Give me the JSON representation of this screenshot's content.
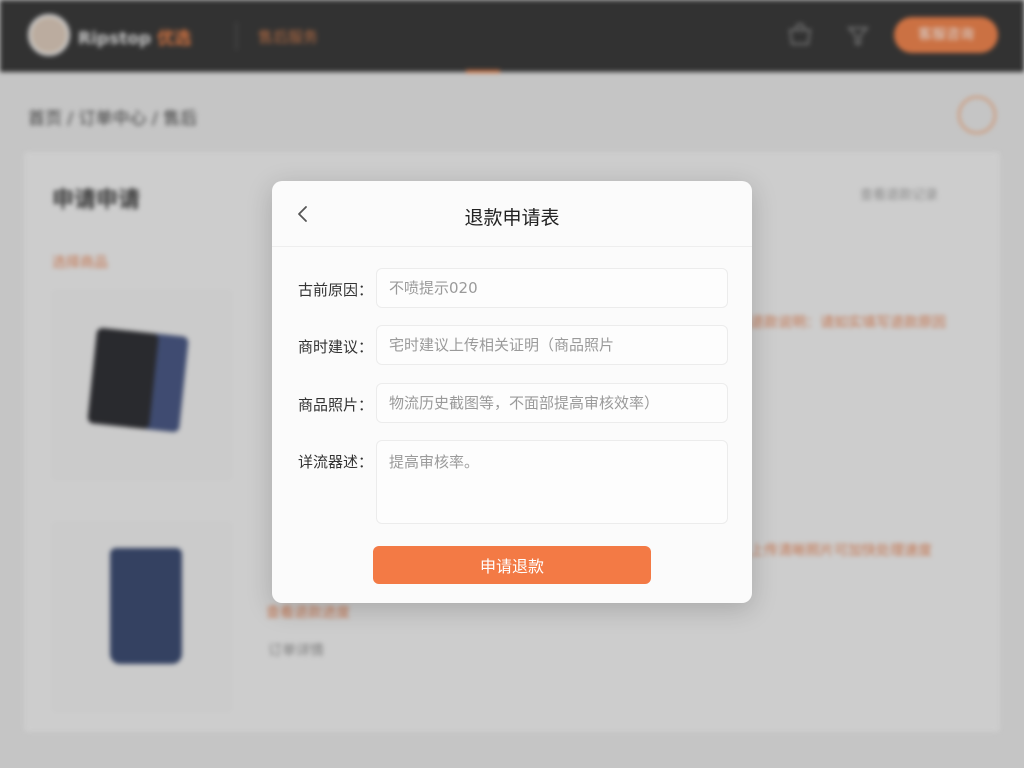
{
  "header": {
    "brand": "Ripstop",
    "brand_accent": "优选",
    "nav_item": "售后服务",
    "action_button": "客服咨询"
  },
  "breadcrumb": "首页 / 订单中心 / 售后",
  "panel": {
    "title": "申请申请",
    "subtitle": "选择商品",
    "right_link": "查看退款记录"
  },
  "side_notes": {
    "note_1": "退款说明：请如实填写退款原因",
    "note_2": "上传清晰照片可加快处理速度",
    "note_3": "查看退款进度",
    "note_4": "订单详情"
  },
  "modal": {
    "title": "退款申请表",
    "fields": [
      {
        "label": "古前原因：",
        "placeholder": "不喷提示020"
      },
      {
        "label": "商时建议：",
        "placeholder": "宅时建议上传相关证明（商品照片"
      },
      {
        "label": "商品照片：",
        "placeholder": "物流历史截图等，不面部提高审核效率）"
      },
      {
        "label": "详流器述：",
        "placeholder": "提高审核率。"
      }
    ],
    "submit_label": "申请退款"
  },
  "colors": {
    "accent": "#F37A45",
    "topbar": "#2A2A2A",
    "modal_bg": "#FBFBFB"
  },
  "icons": {
    "back": "chevron-left-icon",
    "cart": "cart-icon",
    "filter": "filter-icon",
    "help": "help-circle-icon"
  }
}
